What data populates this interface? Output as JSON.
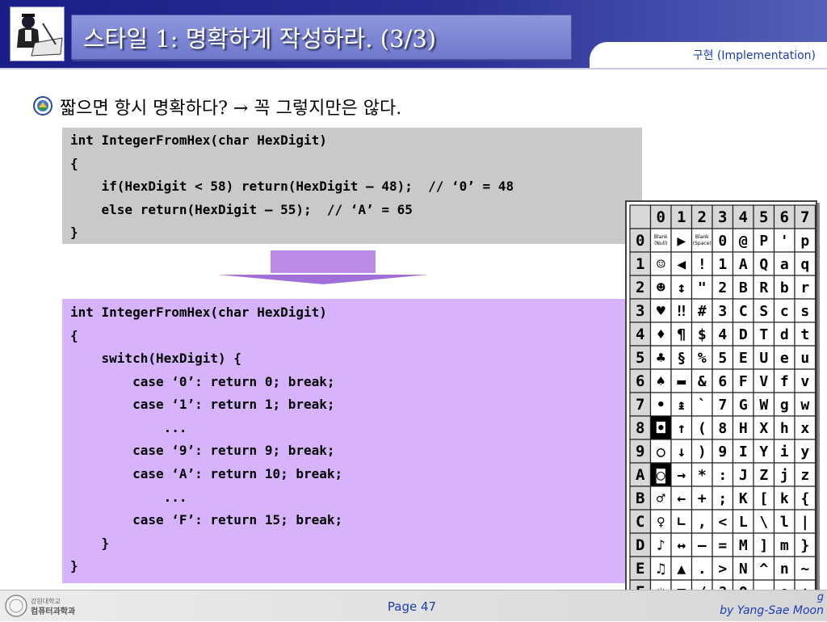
{
  "slide": {
    "title": "스타일 1: 명확하게 작성하라. (3/3)",
    "subtitle": "구현 (Implementation)",
    "bullet": "짧으면 항시 명확하다? → 꼭 그렇지만은 않다."
  },
  "code_before": [
    "int IntegerFromHex(char HexDigit)",
    "{",
    "    if(HexDigit < 58) return(HexDigit – 48);  // ‘0’ = 48",
    "    else return(HexDigit – 55);  // ‘A’ = 65",
    "}"
  ],
  "code_after": [
    "int IntegerFromHex(char HexDigit)",
    "{",
    "    switch(HexDigit) {",
    "        case ‘0’: return 0; break;",
    "        case ‘1’: return 1; break;",
    "            ...",
    "        case ‘9’: return 9; break;",
    "        case ‘A’: return 10; break;",
    "            ...",
    "        case ‘F’: return 15; break;",
    "    }",
    "}"
  ],
  "ascii_table": {
    "col_headers": [
      "0",
      "1",
      "2",
      "3",
      "4",
      "5",
      "6",
      "7"
    ],
    "row_headers": [
      "0",
      "1",
      "2",
      "3",
      "4",
      "5",
      "6",
      "7",
      "8",
      "9",
      "A",
      "B",
      "C",
      "D",
      "E",
      "F"
    ],
    "cells": [
      [
        "Blank (Null)",
        "▶",
        "Blank (Space)",
        "0",
        "@",
        "P",
        "'",
        "p"
      ],
      [
        "☺",
        "◀",
        "!",
        "1",
        "A",
        "Q",
        "a",
        "q"
      ],
      [
        "☻",
        "↕",
        "\"",
        "2",
        "B",
        "R",
        "b",
        "r"
      ],
      [
        "♥",
        "‼",
        "#",
        "3",
        "C",
        "S",
        "c",
        "s"
      ],
      [
        "♦",
        "¶",
        "$",
        "4",
        "D",
        "T",
        "d",
        "t"
      ],
      [
        "♣",
        "§",
        "%",
        "5",
        "E",
        "U",
        "e",
        "u"
      ],
      [
        "♠",
        "▬",
        "&",
        "6",
        "F",
        "V",
        "f",
        "v"
      ],
      [
        "•",
        "↨",
        "`",
        "7",
        "G",
        "W",
        "g",
        "w"
      ],
      [
        "◘",
        "↑",
        "(",
        "8",
        "H",
        "X",
        "h",
        "x"
      ],
      [
        "○",
        "↓",
        ")",
        "9",
        "I",
        "Y",
        "i",
        "y"
      ],
      [
        "◙",
        "→",
        "*",
        ":",
        "J",
        "Z",
        "j",
        "z"
      ],
      [
        "♂",
        "←",
        "+",
        ";",
        "K",
        "[",
        "k",
        "{"
      ],
      [
        "♀",
        "∟",
        ",",
        "<",
        "L",
        "\\",
        "l",
        "|"
      ],
      [
        "♪",
        "↔",
        "–",
        "=",
        "M",
        "]",
        "m",
        "}"
      ],
      [
        "♫",
        "▲",
        ".",
        ">",
        "N",
        "^",
        "n",
        "~"
      ],
      [
        "☼",
        "▼",
        "/",
        "?",
        "O",
        "_",
        "o",
        "⌂"
      ]
    ]
  },
  "footer": {
    "page": "Page 47",
    "author": "by Yang-Sae Moon",
    "author_partial": "g",
    "logo_line1": "강원대학교",
    "logo_line2": "컴퓨터과학과"
  },
  "colors": {
    "header_blue": "#1a1f87",
    "title_box": "#7f88d6",
    "code_before_bg": "#c9c9c9",
    "code_after_bg": "#d6b3fa",
    "arrow": "#b98ae8",
    "accent_text": "#1a3db0"
  },
  "icons": {
    "logo": "person-at-desk-icon",
    "bullet": "university-seal-icon",
    "footer_logo": "university-seal-icon",
    "arrow": "down-arrow-icon"
  }
}
